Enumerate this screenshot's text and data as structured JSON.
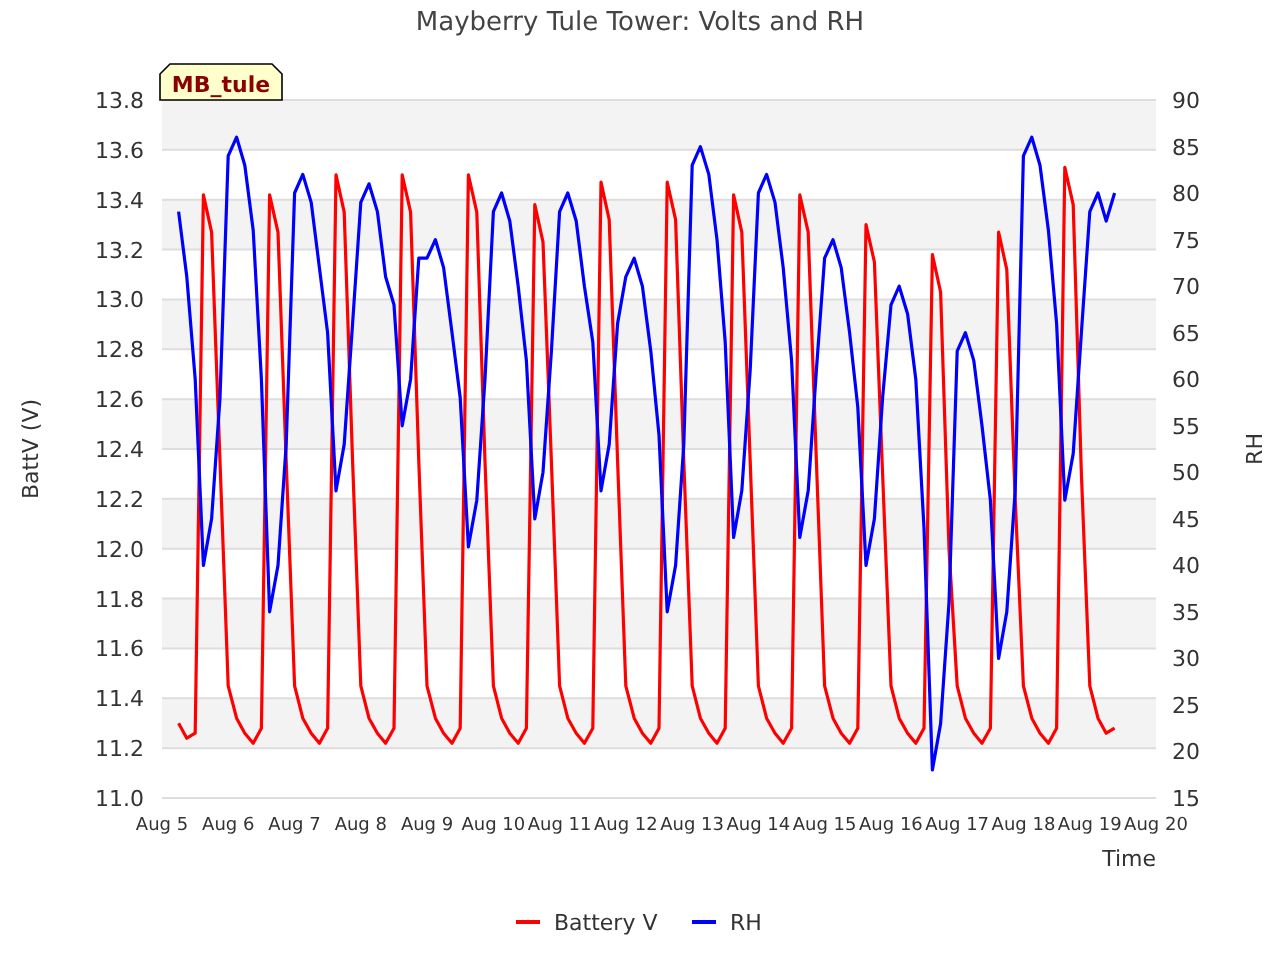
{
  "station_tag": "MB_tule",
  "chart_data": {
    "type": "line",
    "grid": true,
    "legend": "bottom",
    "title": "Mayberry Tule Tower: Volts and RH",
    "xlabel": "Time",
    "ylabel": "BattV (V)",
    "y2label": "RH",
    "categories": [
      "Aug 5",
      null,
      null,
      null,
      null,
      null,
      null,
      null,
      "Aug 6",
      null,
      null,
      null,
      null,
      null,
      null,
      null,
      "Aug 7",
      null,
      null,
      null,
      null,
      null,
      null,
      null,
      "Aug 8",
      null,
      null,
      null,
      null,
      null,
      null,
      null,
      "Aug 9",
      null,
      null,
      null,
      null,
      null,
      null,
      null,
      "Aug 10",
      null,
      null,
      null,
      null,
      null,
      null,
      null,
      "Aug 11",
      null,
      null,
      null,
      null,
      null,
      null,
      null,
      "Aug 12",
      null,
      null,
      null,
      null,
      null,
      null,
      null,
      "Aug 13",
      null,
      null,
      null,
      null,
      null,
      null,
      null,
      "Aug 14",
      null,
      null,
      null,
      null,
      null,
      null,
      null,
      "Aug 15",
      null,
      null,
      null,
      null,
      null,
      null,
      null,
      "Aug 16",
      null,
      null,
      null,
      null,
      null,
      null,
      null,
      "Aug 17",
      null,
      null,
      null,
      null,
      null,
      null,
      null,
      "Aug 18",
      null,
      null,
      null,
      null,
      null,
      null,
      null,
      "Aug 19",
      null,
      null,
      null,
      null,
      null,
      null,
      null,
      "Aug 20"
    ],
    "ylim": [
      11.0,
      13.8
    ],
    "y2lim": [
      15,
      90
    ],
    "yticks": [
      {
        "value": 11.0,
        "label": "11.0"
      },
      {
        "value": 11.2,
        "label": "11.2"
      },
      {
        "value": 11.4,
        "label": "11.4"
      },
      {
        "value": 11.6,
        "label": "11.6"
      },
      {
        "value": 11.8,
        "label": "11.8"
      },
      {
        "value": 12.0,
        "label": "12.0"
      },
      {
        "value": 12.2,
        "label": "12.2"
      },
      {
        "value": 12.4,
        "label": "12.4"
      },
      {
        "value": 12.6,
        "label": "12.6"
      },
      {
        "value": 12.8,
        "label": "12.8"
      },
      {
        "value": 13.0,
        "label": "13.0"
      },
      {
        "value": 13.2,
        "label": "13.2"
      },
      {
        "value": 13.4,
        "label": "13.4"
      },
      {
        "value": 13.6,
        "label": "13.6"
      },
      {
        "value": 13.8,
        "label": "13.8"
      }
    ],
    "y2ticks": [
      15,
      20,
      25,
      30,
      35,
      40,
      45,
      50,
      55,
      60,
      65,
      70,
      75,
      80,
      85,
      90
    ],
    "series": [
      {
        "name": "Battery V",
        "color": "#ff0000",
        "values": [
          null,
          null,
          11.3,
          11.24,
          11.26,
          13.42,
          13.27,
          12.35,
          11.45,
          11.32,
          11.26,
          11.22,
          11.28,
          13.42,
          13.27,
          12.35,
          11.45,
          11.32,
          11.26,
          11.22,
          11.28,
          13.5,
          13.35,
          12.35,
          11.45,
          11.32,
          11.26,
          11.22,
          11.28,
          13.5,
          13.35,
          12.35,
          11.45,
          11.32,
          11.26,
          11.22,
          11.28,
          13.5,
          13.35,
          12.35,
          11.45,
          11.32,
          11.26,
          11.22,
          11.28,
          13.38,
          13.23,
          12.35,
          11.45,
          11.32,
          11.26,
          11.22,
          11.28,
          13.47,
          13.32,
          12.35,
          11.45,
          11.32,
          11.26,
          11.22,
          11.28,
          13.47,
          13.32,
          12.35,
          11.45,
          11.32,
          11.26,
          11.22,
          11.28,
          13.42,
          13.27,
          12.35,
          11.45,
          11.32,
          11.26,
          11.22,
          11.28,
          13.42,
          13.27,
          12.35,
          11.45,
          11.32,
          11.26,
          11.22,
          11.28,
          13.3,
          13.15,
          12.3,
          11.45,
          11.32,
          11.26,
          11.22,
          11.28,
          13.18,
          13.03,
          12.0,
          11.45,
          11.32,
          11.26,
          11.22,
          11.28,
          13.27,
          13.12,
          12.2,
          11.45,
          11.32,
          11.26,
          11.22,
          11.28,
          13.53,
          13.38,
          12.3,
          11.45,
          11.32,
          11.26,
          11.28,
          null,
          null,
          null,
          null,
          null
        ]
      },
      {
        "name": "RH",
        "color": "#0000ff",
        "axis": "y2",
        "values": [
          null,
          null,
          78,
          71,
          60,
          40,
          45,
          58,
          84,
          86,
          83,
          76,
          60,
          35,
          40,
          53,
          80,
          82,
          79,
          72,
          65,
          48,
          53,
          66,
          79,
          81,
          78,
          71,
          68,
          55,
          60,
          73,
          73,
          75,
          72,
          65,
          58,
          42,
          47,
          60,
          78,
          80,
          77,
          70,
          62,
          45,
          50,
          63,
          78,
          80,
          77,
          70,
          64,
          48,
          53,
          66,
          71,
          73,
          70,
          63,
          54,
          35,
          40,
          53,
          83,
          85,
          82,
          75,
          64,
          43,
          48,
          61,
          80,
          82,
          79,
          72,
          62,
          43,
          48,
          61,
          73,
          75,
          72,
          65,
          57,
          40,
          45,
          58,
          68,
          70,
          67,
          60,
          44,
          18,
          23,
          36,
          63,
          65,
          62,
          55,
          47,
          30,
          35,
          48,
          84,
          86,
          83,
          76,
          66,
          47,
          52,
          65,
          78,
          80,
          77,
          80,
          null,
          null,
          null,
          null,
          null
        ]
      }
    ]
  }
}
